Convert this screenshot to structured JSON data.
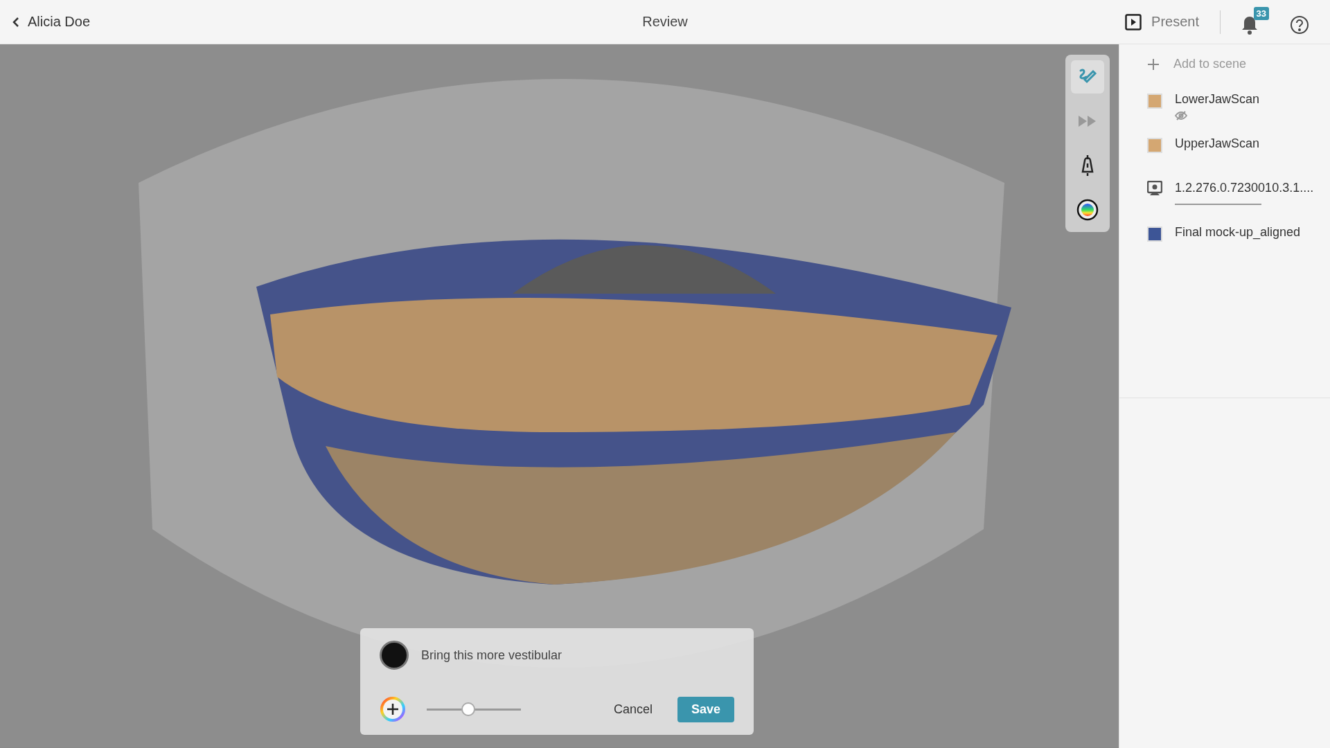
{
  "header": {
    "back_label": "Alicia Doe",
    "title": "Review",
    "present_label": "Present",
    "notifications_count": "33"
  },
  "toolbar": [
    {
      "kind": "draw",
      "selected": true
    },
    {
      "kind": "play",
      "selected": false
    },
    {
      "kind": "clip",
      "selected": false
    },
    {
      "kind": "colormap",
      "selected": false
    }
  ],
  "scene_panel": {
    "add_label": "Add to scene",
    "layers": [
      {
        "kind": "mesh",
        "name": "LowerJawScan",
        "color": "#d4a772",
        "hidden": true
      },
      {
        "kind": "mesh",
        "name": "UpperJawScan",
        "color": "#d4a772",
        "hidden": false
      },
      {
        "kind": "volume",
        "name": "1.2.276.0.7230010.3.1....",
        "hidden": false
      },
      {
        "kind": "mesh",
        "name": "Final mock-up_aligned",
        "color": "#3d5596",
        "hidden": false
      }
    ]
  },
  "comment": {
    "value": "Bring this more vestibular",
    "size": {
      "level": 0.44
    },
    "buttons": [
      {
        "kind": "secondary",
        "label": "Cancel"
      },
      {
        "kind": "primary",
        "label": "Save"
      }
    ]
  }
}
